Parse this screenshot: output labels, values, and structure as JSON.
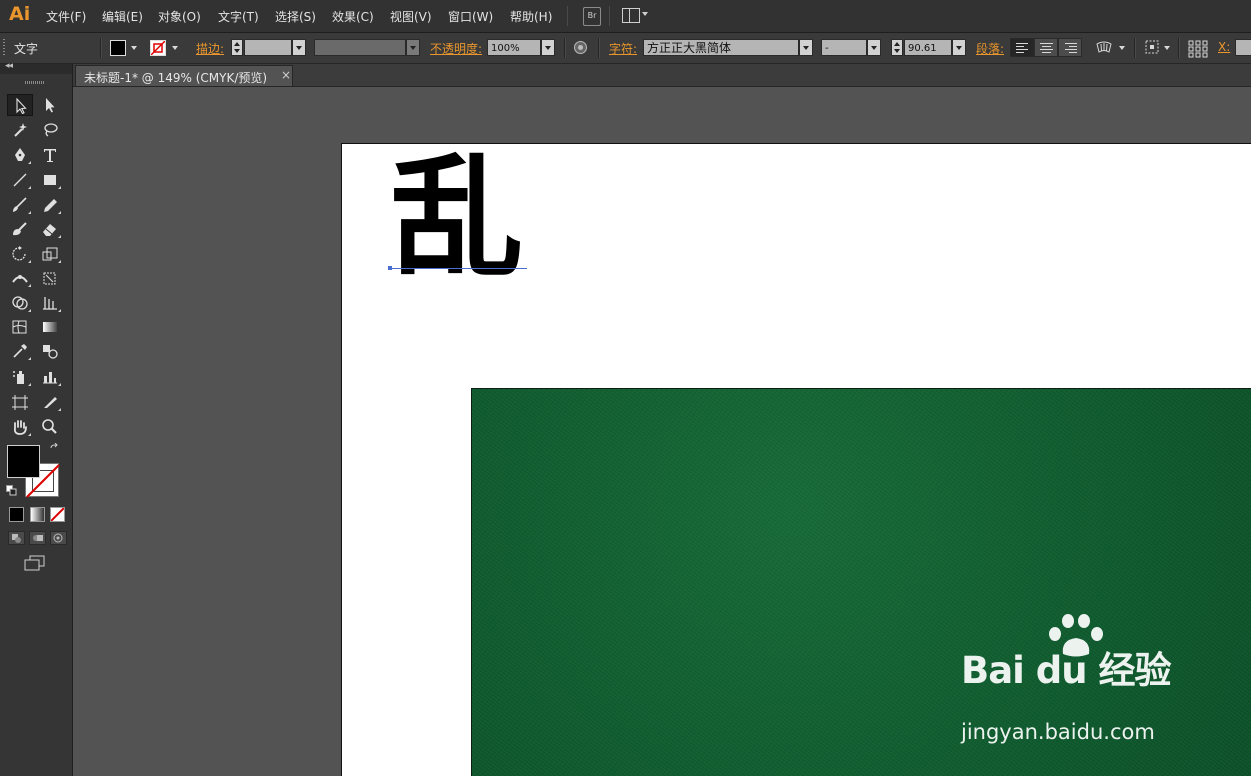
{
  "app": {
    "logo": "Ai"
  },
  "menu": {
    "items": [
      "文件(F)",
      "编辑(E)",
      "对象(O)",
      "文字(T)",
      "选择(S)",
      "效果(C)",
      "视图(V)",
      "窗口(W)",
      "帮助(H)"
    ],
    "bridge_label": "Br"
  },
  "control_bar": {
    "tool_name": "文字",
    "stroke_label": "描边:",
    "opacity_label": "不透明度:",
    "opacity_value": "100%",
    "character_label": "字符:",
    "font_family": "方正正大黑简体",
    "font_style": "-",
    "font_size": "90.61",
    "paragraph_label": "段落:",
    "x_label": "X:"
  },
  "document": {
    "tab_title": "未标题-1* @ 149% (CMYK/预览)",
    "tab_close": "×",
    "text_content": "乱"
  },
  "watermark": {
    "brand": "Bai du 经验",
    "url": "jingyan.baidu.com"
  },
  "colors": {
    "accent": "#e8962d",
    "board_green": "#0f5a2e",
    "selection_blue": "#4a6fd2",
    "fill": "#000000",
    "stroke": "none"
  }
}
